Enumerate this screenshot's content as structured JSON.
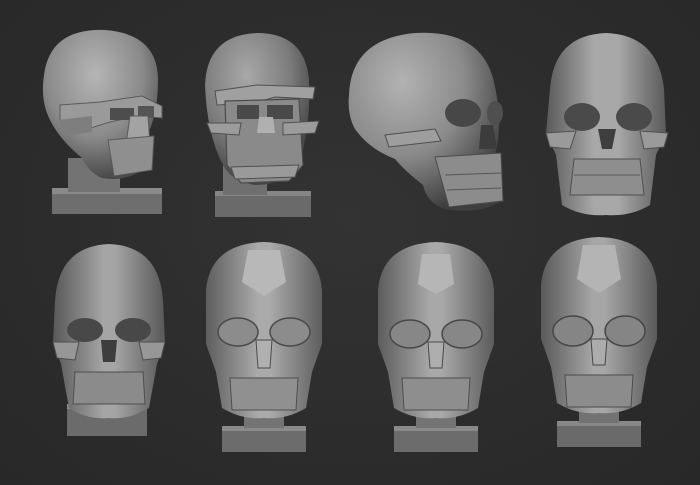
{
  "canvas": {
    "background": "#2d2d2d",
    "material_color": "#8a8a8a",
    "highlight_color": "#b8b8b8",
    "shadow_color": "#3a3a3a"
  },
  "gallery": {
    "rows": [
      {
        "items": [
          {
            "name": "skull-blockout-head-stage-1",
            "view": "three-quarter",
            "pedestal": true
          },
          {
            "name": "skull-blockout-head-stage-2",
            "view": "front-three-quarter",
            "pedestal": true
          },
          {
            "name": "skull-refined-side-view",
            "view": "three-quarter-side",
            "pedestal": false
          },
          {
            "name": "skull-refined-front-view",
            "view": "front",
            "pedestal": false
          }
        ]
      },
      {
        "items": [
          {
            "name": "skull-front-stage-1",
            "view": "front",
            "pedestal": true
          },
          {
            "name": "skull-front-stage-2",
            "view": "front",
            "pedestal": true
          },
          {
            "name": "skull-front-stage-3",
            "view": "front",
            "pedestal": true
          },
          {
            "name": "skull-front-stage-4",
            "view": "front",
            "pedestal": true
          }
        ]
      }
    ]
  }
}
